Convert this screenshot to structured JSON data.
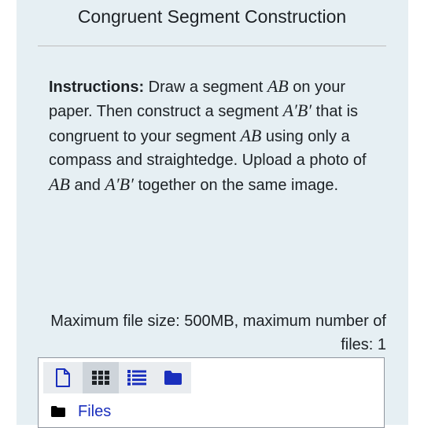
{
  "header": {
    "title": "Congruent Segment Construction"
  },
  "instructions": {
    "label": "Instructions:",
    "t1": " Draw a segment ",
    "m1": "AB",
    "t2": " on your paper. Then construct a segment ",
    "m2": "A′B′",
    "t3": " that is congruent to your segment ",
    "m3": "AB",
    "t4": " using only a compass and straightedge. Upload a photo of ",
    "m4": "AB",
    "t5": " and ",
    "m5": "A′B′",
    "t6": " together on the same image."
  },
  "upload": {
    "limits": "Maximum file size: 500MB, maximum number of files: 1",
    "files_label": "Files"
  },
  "toolbar": {
    "buttons": [
      {
        "icon": "file-icon",
        "active": false
      },
      {
        "icon": "grid-view-icon",
        "active": true
      },
      {
        "icon": "list-view-icon",
        "active": false
      },
      {
        "icon": "folder-tree-icon",
        "active": false
      }
    ]
  },
  "colors": {
    "panel_background": "#e6eff3",
    "link": "#1a2fbd",
    "icon_blue": "#1a2fbd",
    "active_button": "#ced4da"
  }
}
